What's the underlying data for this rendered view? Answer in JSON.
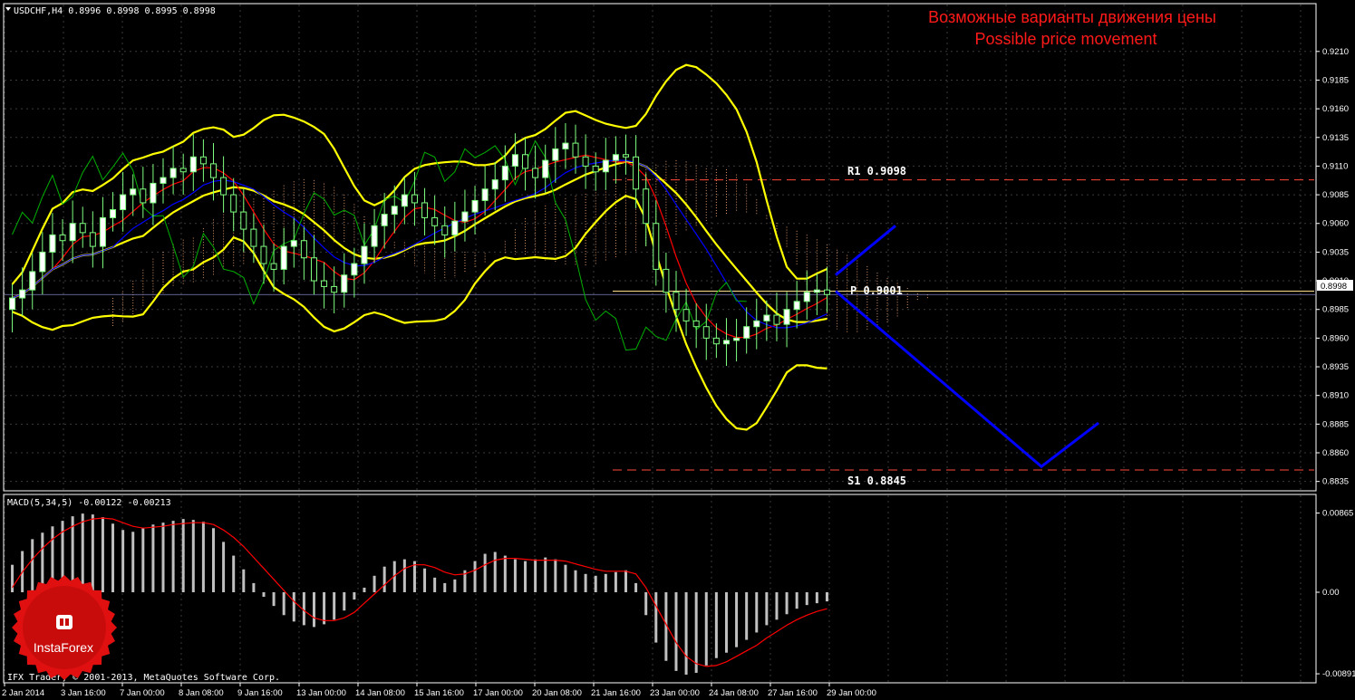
{
  "window": {
    "symbol_caption": "USDCHF,H4  0.8996 0.8998 0.8995 0.8998",
    "copyright": "IFX Trader, © 2001-2013, MetaQuotes Software Corp."
  },
  "annotation": {
    "line1": "Возможные варианты движения цены",
    "line2": "Possible price movement"
  },
  "levels": {
    "r1_label": "R1  0.9098",
    "p_label": "P  0.9001",
    "s1_label": "S1  0.8845",
    "current_price_tag": "0.8998"
  },
  "macd": {
    "caption": "MACD(5,34,5) -0.00122 -0.00213"
  },
  "logo": {
    "text": "InstaForex"
  },
  "colors": {
    "background": "#000000",
    "grid": "#3a3a3a",
    "candles": "#7fff7f",
    "bollinger": "#ffff00",
    "tenkan": "#ff0000",
    "kijun": "#0000ff",
    "chikou": "#00b000",
    "kumo": "#ffb07a",
    "forecast": "#0000ff",
    "macd_hist": "#c0c0c0",
    "macd_signal": "#ff0000",
    "level_lines": "#ff4a3a",
    "logo": "#e01010"
  },
  "chart_data": [
    {
      "type": "line",
      "title": "USDCHF,H4",
      "y_ticks": [
        "0.9210",
        "0.9185",
        "0.9160",
        "0.9135",
        "0.9110",
        "0.9085",
        "0.9060",
        "0.9035",
        "0.9010",
        "0.8985",
        "0.8960",
        "0.8935",
        "0.8910",
        "0.8885",
        "0.8860",
        "0.8835"
      ],
      "ylim": [
        0.883,
        0.9228
      ],
      "x_ticks": [
        "2 Jan 2014",
        "3 Jan 16:00",
        "7 Jan 00:00",
        "8 Jan 08:00",
        "9 Jan 16:00",
        "13 Jan 00:00",
        "14 Jan 08:00",
        "15 Jan 16:00",
        "17 Jan 00:00",
        "20 Jan 08:00",
        "21 Jan 16:00",
        "23 Jan 00:00",
        "24 Jan 08:00",
        "27 Jan 16:00",
        "29 Jan 00:00"
      ],
      "current_price": 0.8998,
      "pivot_levels": {
        "R1": 0.9098,
        "P": 0.9001,
        "S1": 0.8845
      },
      "close": [
        0.8995,
        0.9002,
        0.9018,
        0.9035,
        0.905,
        0.9045,
        0.906,
        0.9052,
        0.904,
        0.9065,
        0.9072,
        0.9085,
        0.909,
        0.9078,
        0.9095,
        0.91,
        0.9108,
        0.9105,
        0.9118,
        0.9112,
        0.91,
        0.9085,
        0.907,
        0.9055,
        0.904,
        0.9025,
        0.902,
        0.904,
        0.9045,
        0.903,
        0.901,
        0.9005,
        0.9,
        0.9015,
        0.9025,
        0.904,
        0.9058,
        0.9068,
        0.9075,
        0.9085,
        0.9078,
        0.9065,
        0.9058,
        0.905,
        0.9062,
        0.907,
        0.908,
        0.909,
        0.9098,
        0.911,
        0.912,
        0.9108,
        0.91,
        0.9115,
        0.9125,
        0.913,
        0.9118,
        0.911,
        0.9105,
        0.9115,
        0.912,
        0.9118,
        0.909,
        0.906,
        0.902,
        0.9,
        0.8985,
        0.8975,
        0.897,
        0.896,
        0.8955,
        0.8958,
        0.896,
        0.897,
        0.8975,
        0.898,
        0.8972,
        0.8985,
        0.8992,
        0.9,
        0.9002,
        0.8998
      ],
      "forecast_up": [
        [
          0.9015,
          0.9058
        ]
      ],
      "forecast_down": [
        [
          0.9001,
          0.8848,
          0.8886
        ]
      ]
    },
    {
      "type": "bar",
      "title": "MACD(5,34,5)",
      "y_ticks": [
        "0.00865",
        "0.00",
        "-0.00891"
      ],
      "ylim": [
        -0.0093,
        0.0093
      ],
      "values": [
        0.003,
        0.0045,
        0.0058,
        0.0065,
        0.0072,
        0.0078,
        0.0083,
        0.0086,
        0.0085,
        0.0082,
        0.0075,
        0.0068,
        0.0066,
        0.007,
        0.0074,
        0.0076,
        0.0078,
        0.008,
        0.0079,
        0.0077,
        0.007,
        0.0055,
        0.004,
        0.0025,
        0.001,
        -0.0005,
        -0.0015,
        -0.0025,
        -0.0032,
        -0.0036,
        -0.0038,
        -0.0035,
        -0.003,
        -0.002,
        -0.0008,
        0.0005,
        0.0018,
        0.0028,
        0.0034,
        0.0036,
        0.0034,
        0.0026,
        0.0016,
        0.001,
        0.0014,
        0.0024,
        0.0034,
        0.0042,
        0.0044,
        0.004,
        0.0036,
        0.0034,
        0.0036,
        0.0038,
        0.0036,
        0.003,
        0.0024,
        0.002,
        0.0018,
        0.002,
        0.0022,
        0.0024,
        0.001,
        -0.0025,
        -0.0055,
        -0.0075,
        -0.0086,
        -0.009,
        -0.0088,
        -0.008,
        -0.0072,
        -0.0066,
        -0.006,
        -0.0052,
        -0.0044,
        -0.0036,
        -0.003,
        -0.0024,
        -0.0018,
        -0.0014,
        -0.0012,
        -0.001
      ],
      "signal": [
        0.0005,
        0.0022,
        0.0036,
        0.0048,
        0.0058,
        0.0066,
        0.0072,
        0.0077,
        0.008,
        0.0081,
        0.008,
        0.0076,
        0.0072,
        0.007,
        0.0071,
        0.0072,
        0.0074,
        0.0075,
        0.0076,
        0.0076,
        0.0074,
        0.0068,
        0.006,
        0.005,
        0.0038,
        0.0026,
        0.0014,
        0.0002,
        -0.001,
        -0.002,
        -0.0028,
        -0.0031,
        -0.0031,
        -0.0028,
        -0.0022,
        -0.0012,
        -0.0002,
        0.0008,
        0.0018,
        0.0026,
        0.003,
        0.003,
        0.0027,
        0.0022,
        0.0019,
        0.002,
        0.0024,
        0.003,
        0.0035,
        0.0037,
        0.0037,
        0.0036,
        0.0035,
        0.0035,
        0.0035,
        0.0034,
        0.0031,
        0.0028,
        0.0025,
        0.0023,
        0.0023,
        0.0023,
        0.002,
        0.0005,
        -0.0015,
        -0.0035,
        -0.0055,
        -0.007,
        -0.0078,
        -0.0081,
        -0.008,
        -0.0076,
        -0.007,
        -0.0064,
        -0.0058,
        -0.005,
        -0.0043,
        -0.0036,
        -0.003,
        -0.0025,
        -0.0021,
        -0.0018
      ]
    }
  ]
}
